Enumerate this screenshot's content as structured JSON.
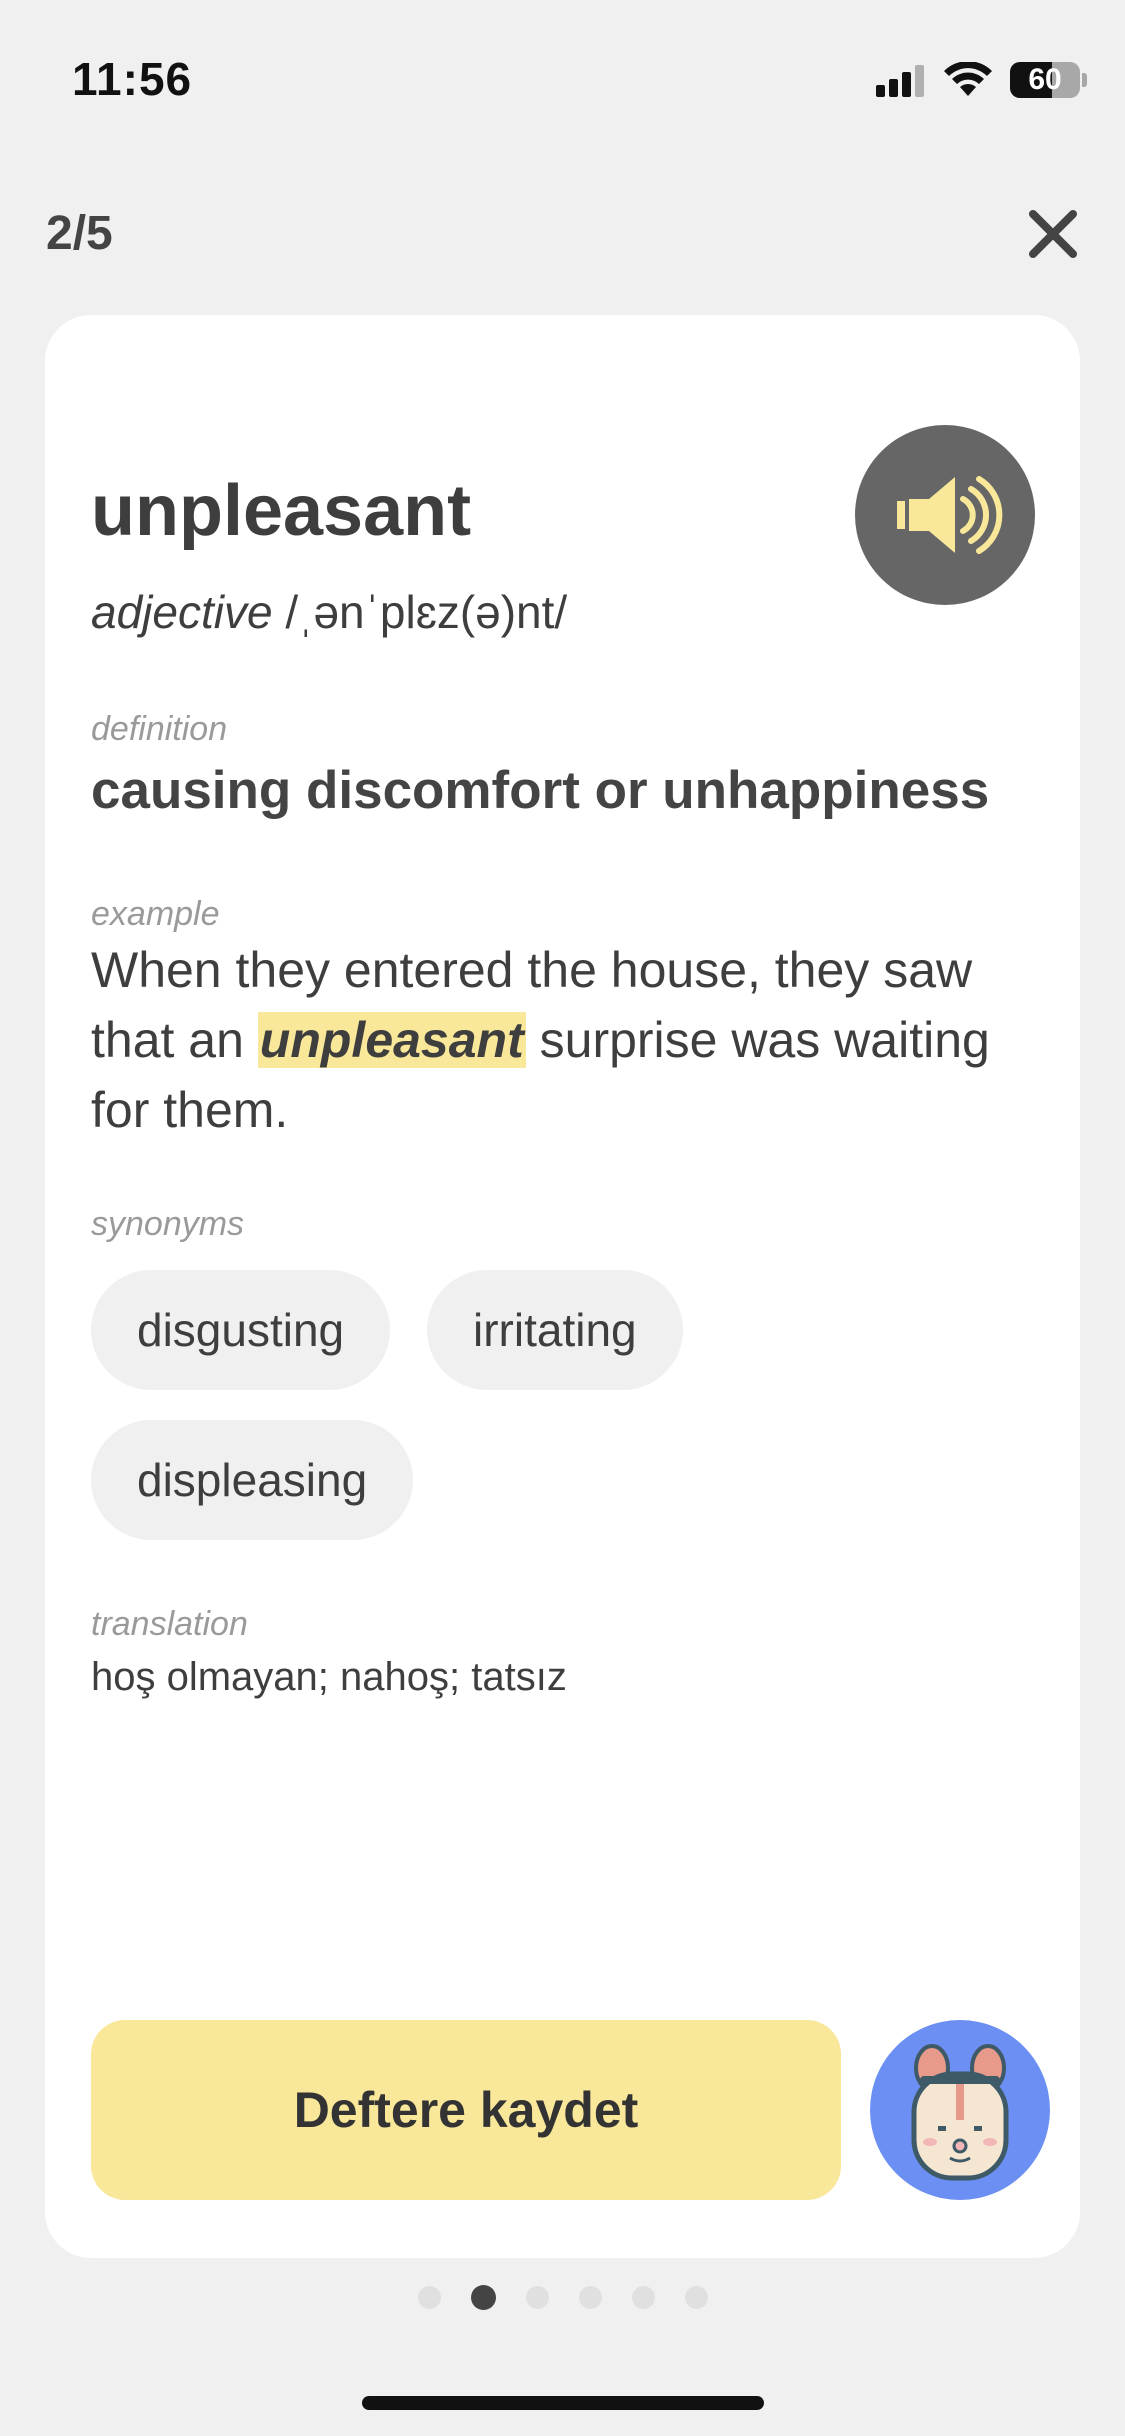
{
  "status_bar": {
    "time": "11:56",
    "battery_level": "60",
    "icons": [
      "cellular-signal-icon",
      "wifi-icon",
      "battery-icon"
    ]
  },
  "nav": {
    "progress_counter": "2/5",
    "close_icon": "close-icon"
  },
  "card": {
    "word": "unpleasant",
    "part_of_speech": "adjective",
    "pronunciation": "/ˌənˈplɛz(ə)nt/",
    "speaker_icon": "speaker-icon",
    "definition_label": "definition",
    "definition": "causing discomfort or unhappiness",
    "example_label": "example",
    "example_before": "When they entered the house, they saw that an ",
    "example_highlight": "unpleasant",
    "example_after": " surprise was waiting for them.",
    "synonyms_label": "synonyms",
    "synonyms": [
      "disgusting",
      "irritating",
      "displeasing"
    ],
    "translation_label": "translation",
    "translation": "hoş olmayan; nahoş; tatsız",
    "save_button_label": "Deftere kaydet",
    "mascot_icon": "bunny-mascot-icon"
  },
  "pagination": {
    "total": 6,
    "active_index": 1
  },
  "colors": {
    "accent_yellow": "#f9e79a",
    "speaker_bg": "#666666",
    "mascot_bg": "#6b8ff2",
    "chip_bg": "#f0f0f0",
    "page_bg": "#f0f0f0"
  }
}
